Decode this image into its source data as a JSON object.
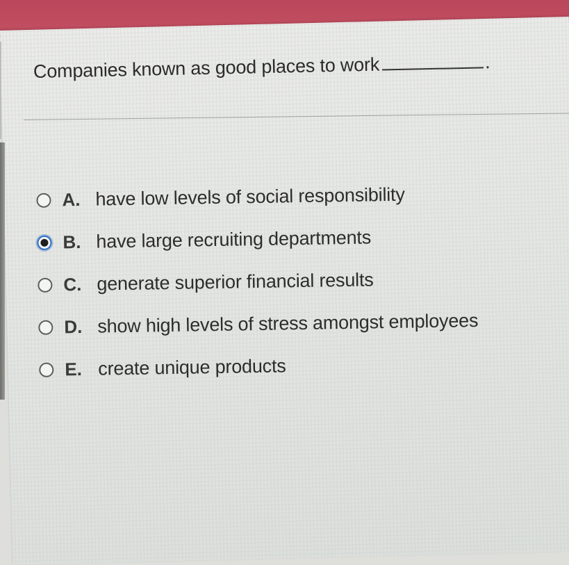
{
  "question": {
    "text": "Companies known as good places to work",
    "blank_suffix": "."
  },
  "options": [
    {
      "letter": "A.",
      "text": "have low levels of social responsibility",
      "selected": false
    },
    {
      "letter": "B.",
      "text": "have large recruiting departments",
      "selected": true
    },
    {
      "letter": "C.",
      "text": "generate superior financial results",
      "selected": false
    },
    {
      "letter": "D.",
      "text": "show high levels of stress amongst employees",
      "selected": false
    },
    {
      "letter": "E.",
      "text": "create unique products",
      "selected": false
    }
  ],
  "colors": {
    "top_bar": "#c14d60",
    "selected_ring": "#2f6fc7",
    "text": "#2c2c2c"
  }
}
